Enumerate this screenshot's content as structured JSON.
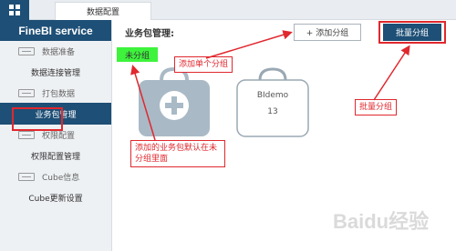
{
  "topbar": {
    "tab_label": "数据配置",
    "apps_icon": "grid-icon"
  },
  "sidebar": {
    "header": "FineBI service",
    "items": [
      {
        "type": "section",
        "label": "数据准备"
      },
      {
        "type": "item",
        "label": "数据连接管理"
      },
      {
        "type": "section",
        "label": "打包数据"
      },
      {
        "type": "item",
        "label": "业务包管理",
        "active": true
      },
      {
        "type": "section",
        "label": "权限配置"
      },
      {
        "type": "item",
        "label": "权限配置管理"
      },
      {
        "type": "section",
        "label": "Cube信息"
      },
      {
        "type": "item",
        "label": "Cube更新设置"
      }
    ]
  },
  "main": {
    "title": "业务包管理:",
    "add_group_label": "+ 添加分组",
    "batch_group_label": "批量分组",
    "ungrouped_label": "未分组",
    "packages": [
      {
        "name": "",
        "icon": "plus-icon"
      },
      {
        "name": "BIdemo",
        "count": "13"
      }
    ]
  },
  "annotations": {
    "add_single": "添加单个分组",
    "batch": "批量分组",
    "default_note": "添加的业务包默认在未分组里面"
  },
  "colors": {
    "navy": "#1e4f76",
    "red": "#e0282e",
    "green": "#3ef33c"
  },
  "watermark": "Baidu经验"
}
